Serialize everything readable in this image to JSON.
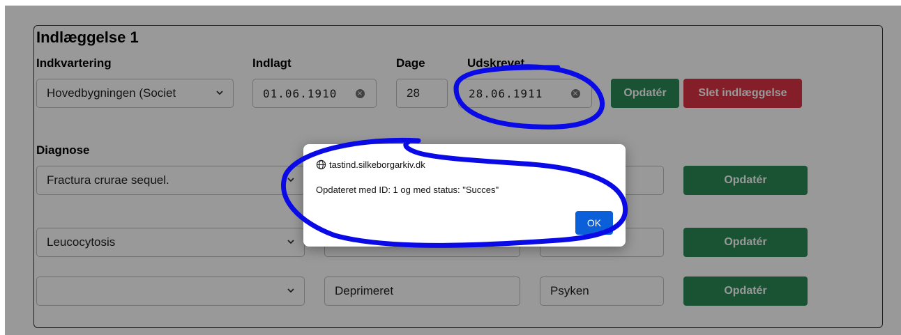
{
  "admission": {
    "title": "Indlæggelse 1",
    "labels": {
      "lodging": "Indkvartering",
      "admitted": "Indlagt",
      "days": "Dage",
      "discharged": "Udskrevet"
    },
    "lodging_value": "Hovedbygningen (Societ",
    "admitted_value": "01.06.1910",
    "days_value": "28",
    "discharged_value": "28.06.1911",
    "update_label": "Opdatér",
    "delete_label": "Slet indlæggelse"
  },
  "diagnosis": {
    "label": "Diagnose",
    "rows": [
      {
        "diagnosis": "Fractura crurae sequel.",
        "description": "",
        "category": "",
        "update_label": "Opdatér"
      },
      {
        "diagnosis": "Leucocytosis",
        "description": "",
        "category": "",
        "update_label": "Opdatér"
      },
      {
        "diagnosis": "",
        "description": "Deprimeret",
        "category": "Psyken",
        "update_label": "Opdatér"
      }
    ]
  },
  "dialog": {
    "host": "tastind.silkeborgarkiv.dk",
    "message": "Opdateret med ID: 1 og med status: \"Succes\"",
    "ok_label": "OK"
  },
  "colors": {
    "success_button": "#2b8a57",
    "danger_button": "#dc3545",
    "ok_button": "#0b5fd8",
    "annotation": "#0a0ae6"
  }
}
